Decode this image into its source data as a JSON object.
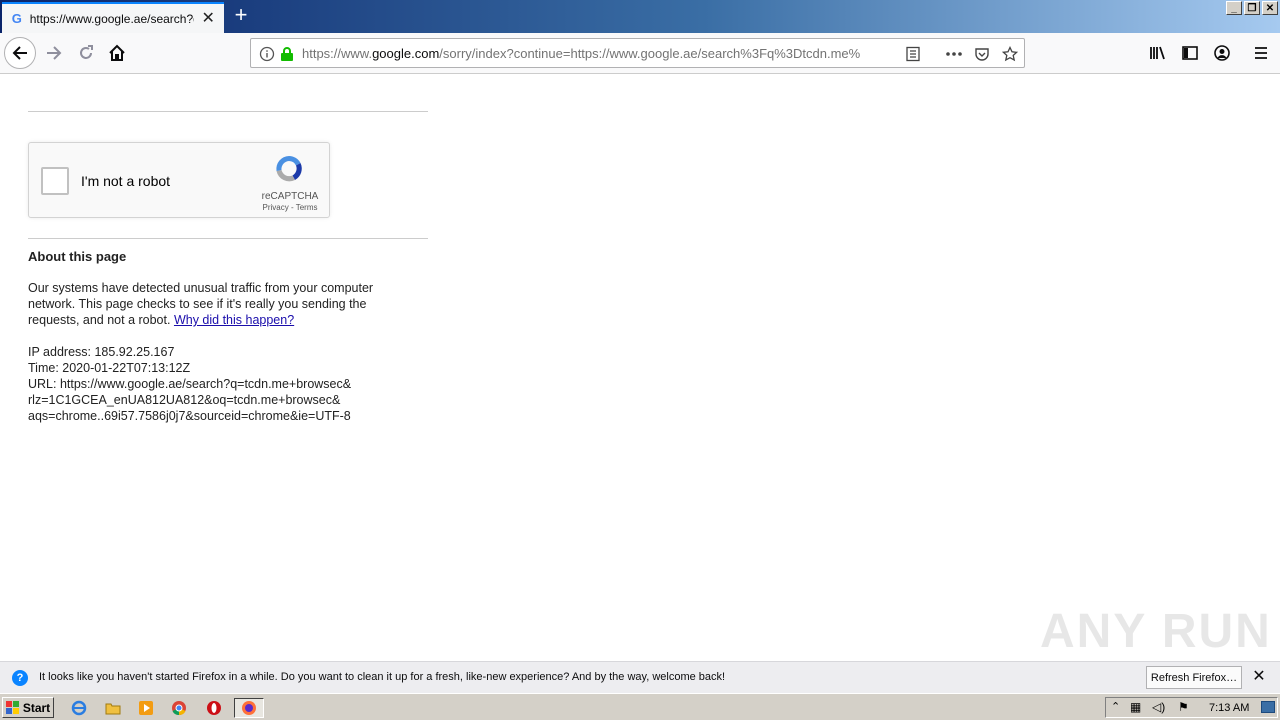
{
  "browser": {
    "tab_title": "https://www.google.ae/search?q=tcdn.me",
    "tab_favicon_letter": "G",
    "url_prefix": "https://www.",
    "url_domain": "google.com",
    "url_rest": "/sorry/index?continue=https://www.google.ae/search%3Fq%3Dtcdn.me%",
    "window_controls": [
      "_",
      "❐",
      "✕"
    ]
  },
  "page": {
    "captcha": {
      "label": "I'm not a robot",
      "brand": "reCAPTCHA",
      "links": "Privacy - Terms"
    },
    "about_title": "About this page",
    "about_text": "Our systems have detected unusual traffic from your computer network. This page checks to see if it's really you sending the requests, and not a robot.",
    "about_link": "Why did this happen?",
    "ip_line": "IP address: 185.92.25.167",
    "time_line": "Time: 2020-01-22T07:13:12Z",
    "url_line_1": "URL: https://www.google.ae/search?q=tcdn.me+browsec&",
    "url_line_2": "rlz=1C1GCEA_enUA812UA812&oq=tcdn.me+browsec&",
    "url_line_3": "aqs=chrome..69i57.7586j0j7&sourceid=chrome&ie=UTF-8",
    "watermark": "ANY RUN"
  },
  "notification": {
    "text": "It looks like you haven't started Firefox in a while. Do you want to clean it up for a fresh, like-new experience? And by the way, welcome back!",
    "button": "Refresh Firefox…"
  },
  "taskbar": {
    "start_label": "Start",
    "clock": "7:13 AM"
  },
  "colors": {
    "accent": "#0a84ff",
    "link": "#1a0dab",
    "secure_lock": "#12bc00"
  }
}
